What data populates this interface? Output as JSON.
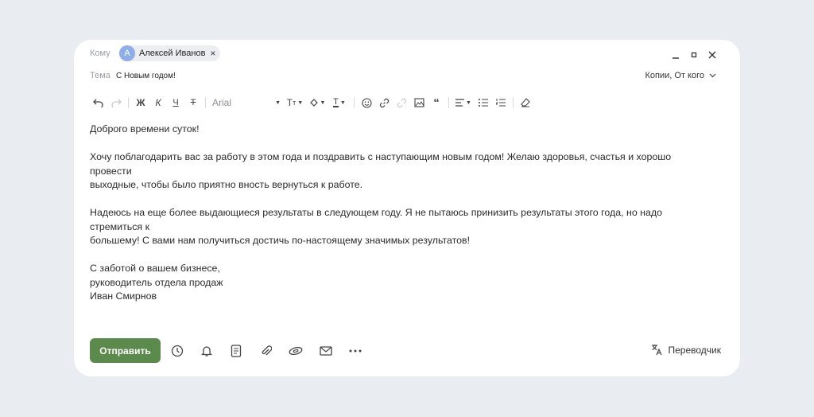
{
  "header": {
    "to_label": "Кому",
    "recipient": {
      "initial": "А",
      "name": "Алексей Иванов",
      "remove": "×"
    },
    "subject_label": "Тема",
    "subject_value": "С Новым годом!",
    "copies_label": "Копии, От кого"
  },
  "toolbar": {
    "font_name": "Arial"
  },
  "message": {
    "greeting": "Доброго времени суток!",
    "para1_line1": "Хочу поблагодарить вас за работу в этом года и поздравить с наступающим новым годом! Желаю здоровья, счастья и хорошо провести",
    "para1_line2": "выходные, чтобы было приятно вность вернуться к работе.",
    "para2_line1": "Надеюсь на еще более выдающиеся результаты в следующем году. Я не пытаюсь принизить результаты этого года, но надо стремиться к",
    "para2_line2": "большему! С вами нам получиться достичь по-настоящему значимых результатов!",
    "sign1": "С заботой о вашем бизнесе,",
    "sign2": "руководитель отдела продаж",
    "sign3": "Иван Смирнов"
  },
  "footer": {
    "send_label": "Отправить",
    "translator_label": "Переводчик",
    "icons": [
      "clock-icon",
      "bell-icon",
      "template-icon",
      "attach-icon",
      "disk-icon",
      "envelope-icon",
      "more-icon"
    ]
  },
  "colors": {
    "accent": "#5b8a4c",
    "avatar": "#8faee8",
    "background": "#e9ecf1"
  }
}
